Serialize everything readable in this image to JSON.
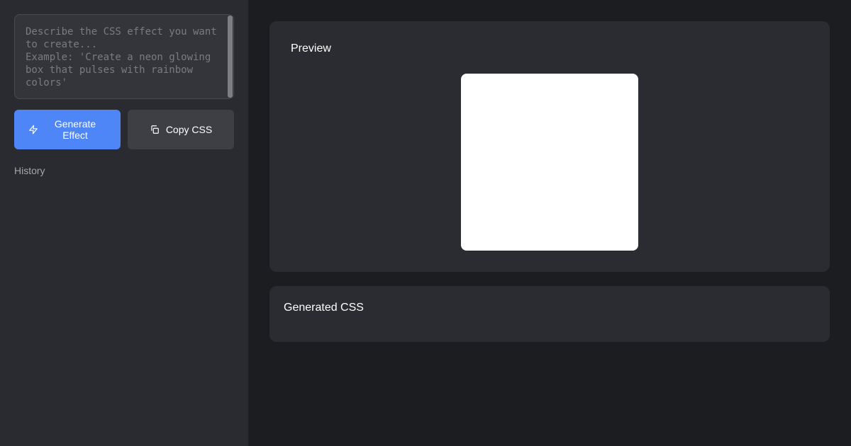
{
  "sidebar": {
    "prompt": {
      "value": "",
      "placeholder": "Describe the CSS effect you want to create...\nExample: 'Create a neon glowing box that pulses with rainbow colors'"
    },
    "generate_button": {
      "label": "Generate Effect",
      "icon": "lightning-icon"
    },
    "copy_button": {
      "label": "Copy CSS",
      "icon": "copy-icon"
    },
    "history_label": "History"
  },
  "main": {
    "preview": {
      "title": "Preview"
    },
    "generated_css": {
      "title": "Generated CSS",
      "code": ""
    }
  },
  "colors": {
    "accent": "#4f86f7",
    "sidebar_bg": "#2a2b30",
    "main_bg": "#1c1d21",
    "card_bg": "#2b2c31",
    "preview_box": "#ffffff"
  }
}
